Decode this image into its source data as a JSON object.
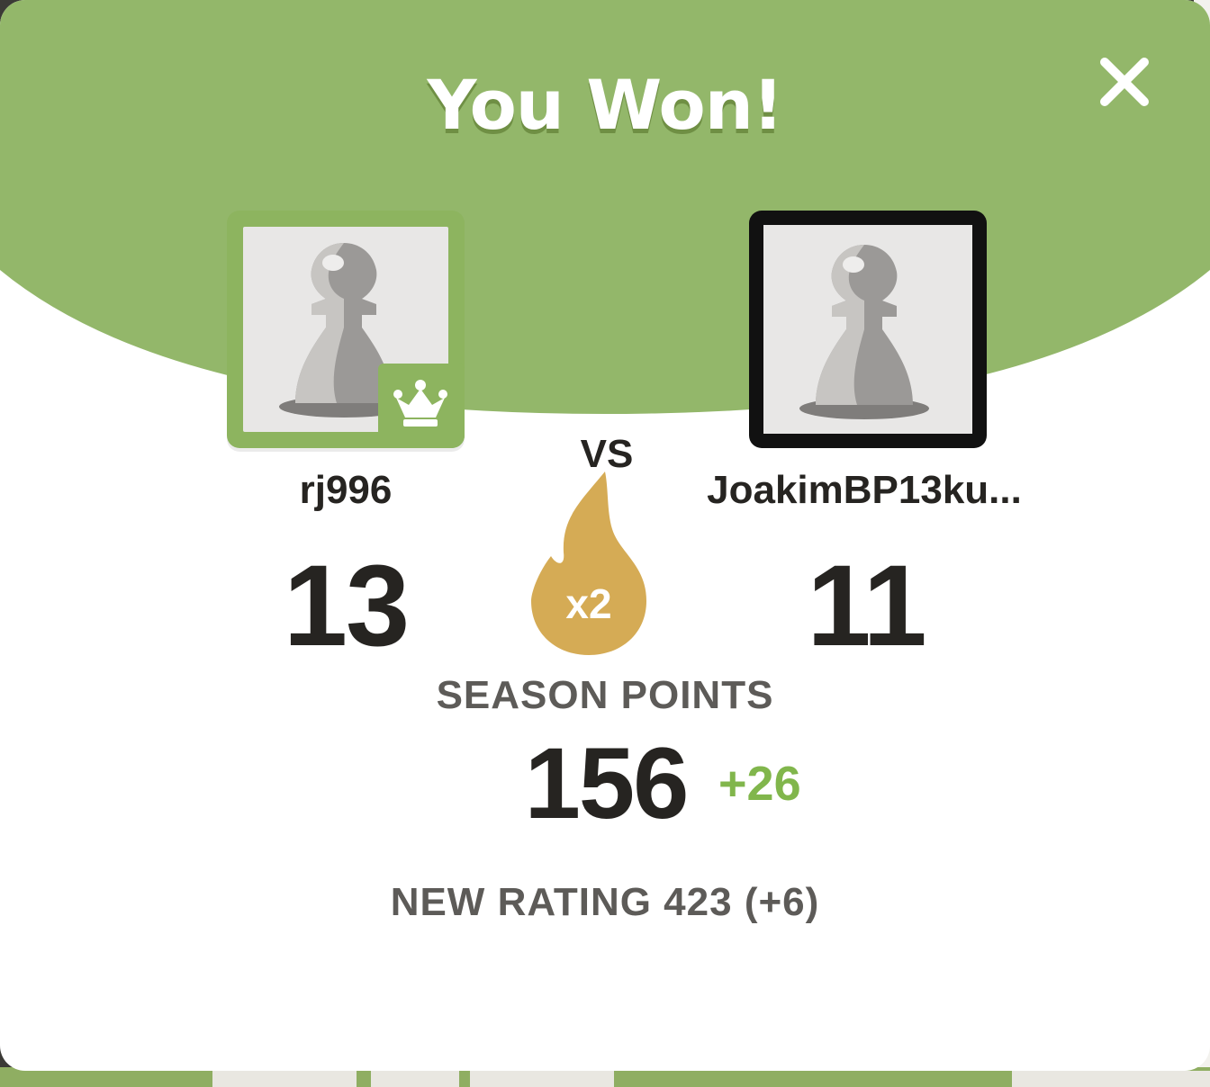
{
  "modal": {
    "title": "You Won!",
    "close_icon": "close-icon",
    "header_color": "#93b76a"
  },
  "players": {
    "me": {
      "name": "rj996",
      "score": "13",
      "avatar_icon": "pawn-icon",
      "badge_icon": "crown-icon"
    },
    "opponent": {
      "name": "JoakimBP13ku...",
      "score": "11",
      "avatar_icon": "pawn-icon"
    }
  },
  "vs_label": "VS",
  "multiplier": {
    "icon": "flame-icon",
    "label": "x2",
    "color": "#d5ab55"
  },
  "season": {
    "label": "SEASON POINTS",
    "value": "156",
    "delta": "+26",
    "delta_color": "#81b64c"
  },
  "rating_text": "NEW RATING 423 (+6)"
}
